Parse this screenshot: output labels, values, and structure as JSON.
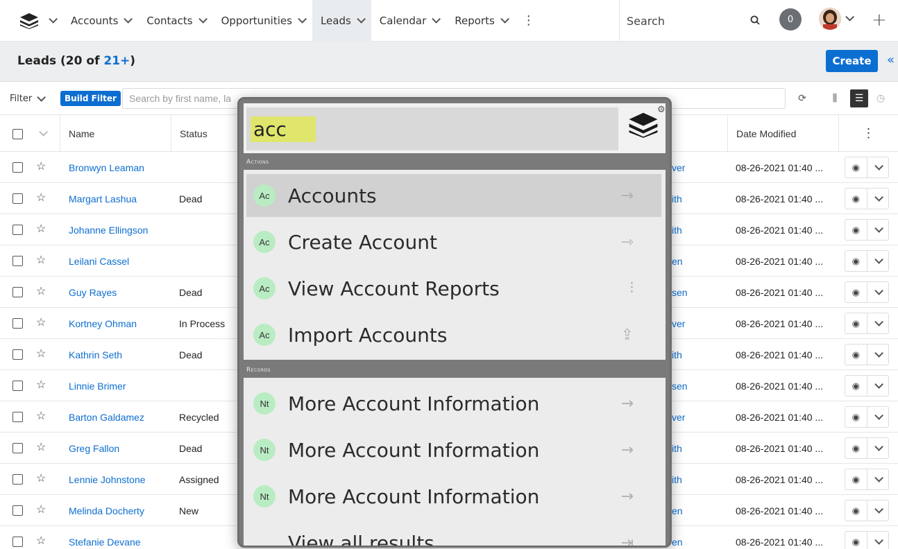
{
  "nav": {
    "items": [
      {
        "label": "Accounts",
        "active": false
      },
      {
        "label": "Contacts",
        "active": false
      },
      {
        "label": "Opportunities",
        "active": false
      },
      {
        "label": "Leads",
        "active": true
      },
      {
        "label": "Calendar",
        "active": false
      },
      {
        "label": "Reports",
        "active": false
      }
    ],
    "search_placeholder": "Search",
    "notification_count": "0"
  },
  "header": {
    "title_prefix": "Leads (20 of ",
    "title_count": "21+",
    "title_suffix": ")",
    "create_label": "Create"
  },
  "filter": {
    "filter_label": "Filter",
    "build_filter_label": "Build Filter",
    "search_placeholder": "Search by first name, la"
  },
  "table": {
    "columns": {
      "name": "Name",
      "status": "Status",
      "date_modified": "Date Modified"
    },
    "rows": [
      {
        "name": "Bronwyn Leaman",
        "status": "",
        "user": "ver",
        "date": "08-26-2021 01:40 ..."
      },
      {
        "name": "Margart Lashua",
        "status": "Dead",
        "user": "ith",
        "date": "08-26-2021 01:40 ..."
      },
      {
        "name": "Johanne Ellingson",
        "status": "",
        "user": "ith",
        "date": "08-26-2021 01:40 ..."
      },
      {
        "name": "Leilani Cassel",
        "status": "",
        "user": "en",
        "date": "08-26-2021 01:40 ..."
      },
      {
        "name": "Guy Rayes",
        "status": "Dead",
        "user": "sen",
        "date": "08-26-2021 01:40 ..."
      },
      {
        "name": "Kortney Ohman",
        "status": "In Process",
        "user": "ver",
        "date": "08-26-2021 01:40 ..."
      },
      {
        "name": "Kathrin Seth",
        "status": "Dead",
        "user": "ith",
        "date": "08-26-2021 01:40 ..."
      },
      {
        "name": "Linnie Brimer",
        "status": "",
        "user": "sen",
        "date": "08-26-2021 01:40 ..."
      },
      {
        "name": "Barton Galdamez",
        "status": "Recycled",
        "user": "ver",
        "date": "08-26-2021 01:40 ..."
      },
      {
        "name": "Greg Fallon",
        "status": "Dead",
        "user": "ith",
        "date": "08-26-2021 01:40 ..."
      },
      {
        "name": "Lennie Johnstone",
        "status": "Assigned",
        "user": "ith",
        "date": "08-26-2021 01:40 ..."
      },
      {
        "name": "Melinda Docherty",
        "status": "New",
        "user": "en",
        "date": "08-26-2021 01:40 ..."
      },
      {
        "name": "Stefanie Devane",
        "status": "",
        "user": "en",
        "date": "08-26-2021 01:40 ..."
      }
    ]
  },
  "quicksearch": {
    "query": "acc",
    "actions_heading": "Actions",
    "records_heading": "Records",
    "actions": [
      {
        "badge": "Ac",
        "label": "Accounts",
        "icon": "arrow-right-icon",
        "selected": true
      },
      {
        "badge": "Ac",
        "label": "Create Account",
        "icon": "create-arrow-icon",
        "selected": false
      },
      {
        "badge": "Ac",
        "label": "View Account Reports",
        "icon": "reports-icon",
        "selected": false
      },
      {
        "badge": "Ac",
        "label": "Import Accounts",
        "icon": "import-icon",
        "selected": false
      }
    ],
    "records": [
      {
        "badge": "Nt",
        "label": "More Account Information"
      },
      {
        "badge": "Nt",
        "label": "More Account Information"
      },
      {
        "badge": "Nt",
        "label": "More Account Information"
      }
    ],
    "view_all_label": "View all results"
  },
  "colors": {
    "accent": "#0d6ed1",
    "highlight": "#e0e66c",
    "badge": "#b9ecc2"
  }
}
